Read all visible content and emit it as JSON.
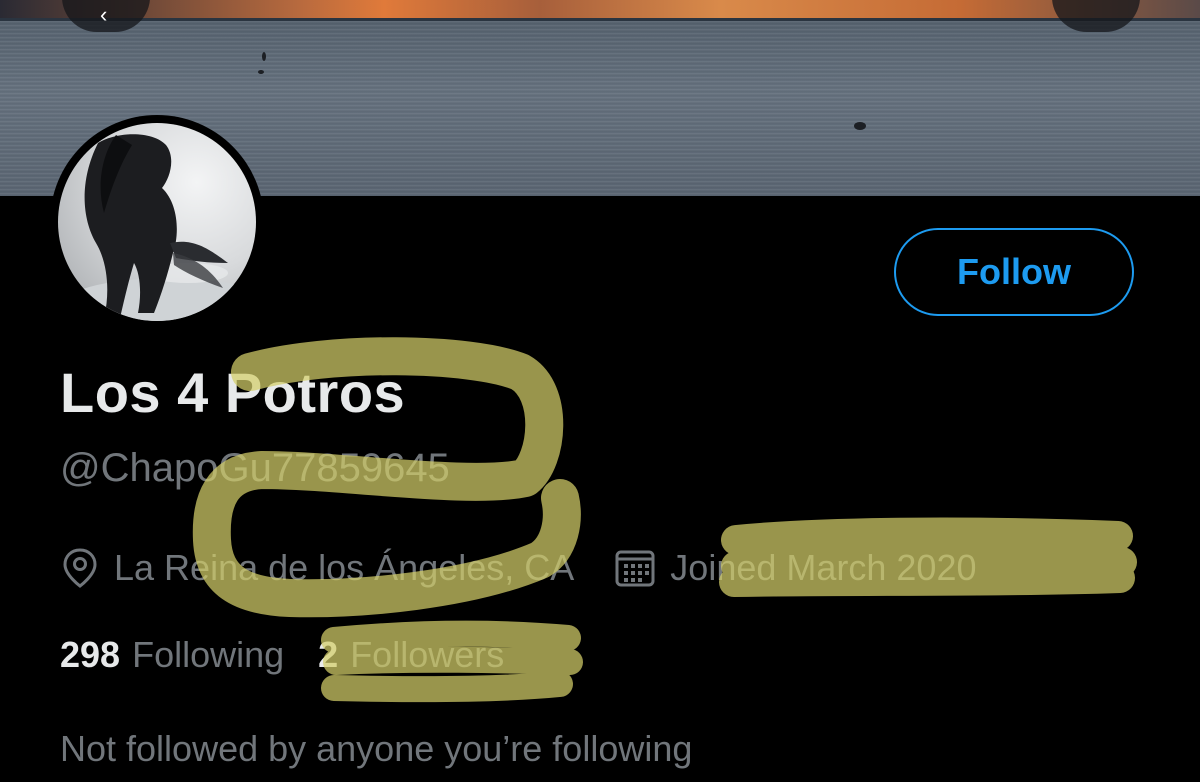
{
  "profile": {
    "display_name": "Los 4 Potros",
    "handle": "@ChapoGu77859645",
    "location": "La Reina de los Ángeles, CA",
    "joined": "Joined March 2020",
    "following_count": "298",
    "following_label": "Following",
    "followers_count": "2",
    "followers_label": "Followers",
    "mutuals_text": "Not followed by anyone you’re following"
  },
  "actions": {
    "follow_label": "Follow",
    "back_icon": "back-arrow-icon",
    "more_icon": "more-icon"
  },
  "icons": {
    "location": "location-pin-icon",
    "joined": "calendar-icon"
  },
  "colors": {
    "accent": "#1d9bf0",
    "background": "#000000",
    "primary_text": "#e7e9ea",
    "secondary_text": "#71767b",
    "highlight": "#d4cf6a"
  }
}
